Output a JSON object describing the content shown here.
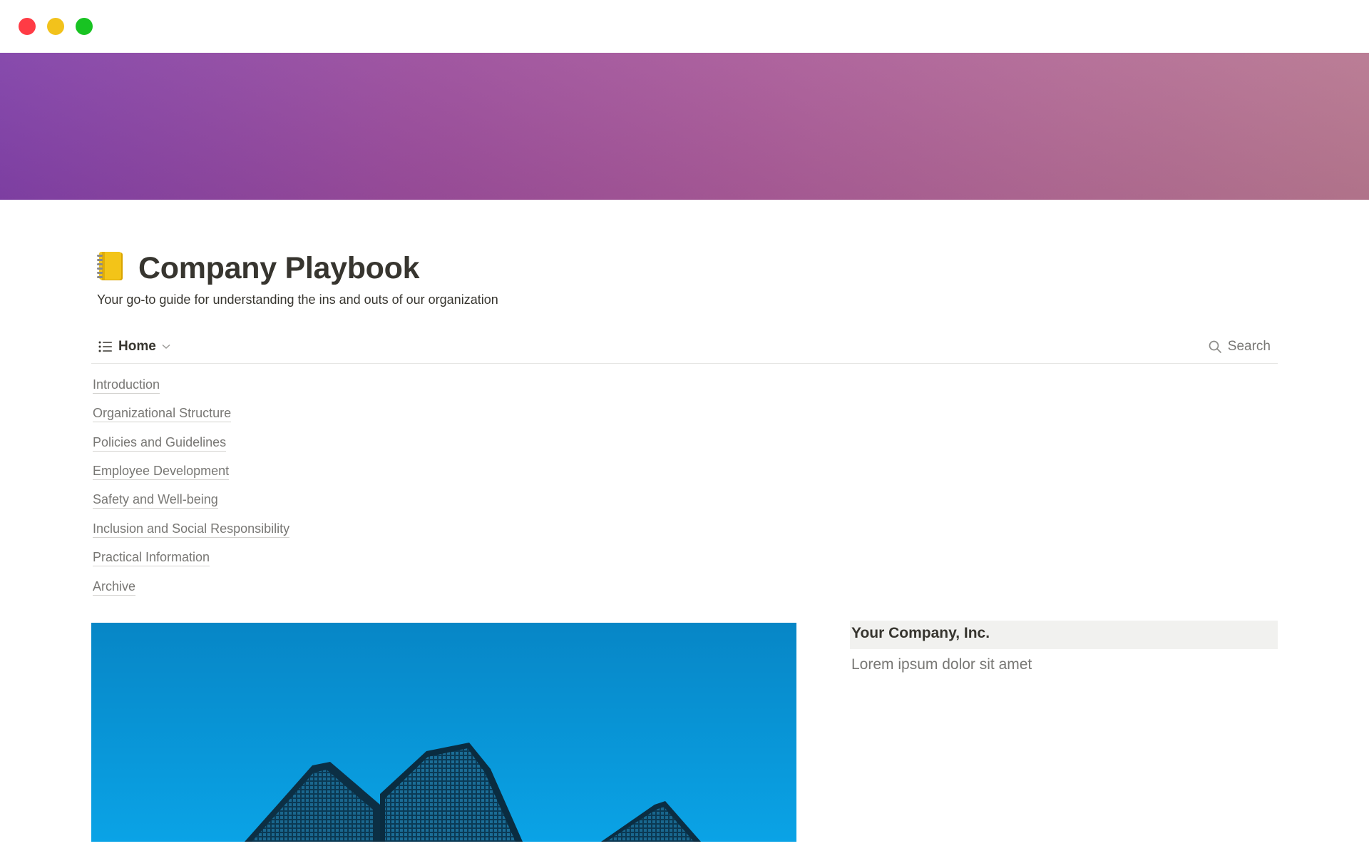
{
  "page": {
    "title": "Company Playbook",
    "subtitle": "Your go-to guide for understanding the ins and outs of our organization",
    "icon": "notebook-icon"
  },
  "view": {
    "tab_label": "Home",
    "tab_icon": "list-icon",
    "search_label": "Search"
  },
  "links": [
    {
      "label": "Introduction"
    },
    {
      "label": "Organizational Structure"
    },
    {
      "label": "Policies and Guidelines"
    },
    {
      "label": "Employee Development"
    },
    {
      "label": "Safety and Well-being"
    },
    {
      "label": "Inclusion and Social Responsibility"
    },
    {
      "label": "Practical Information"
    },
    {
      "label": "Archive"
    }
  ],
  "callout": {
    "title": "Your Company, Inc.",
    "text": "Lorem ipsum dolor sit amet"
  },
  "colors": {
    "cover_start": "#8040a8",
    "cover_end": "#b7778f",
    "text": "#37352f",
    "muted": "#787774",
    "traffic_red": "#ff3b45",
    "traffic_yellow": "#f2c21b",
    "traffic_green": "#18c322"
  }
}
